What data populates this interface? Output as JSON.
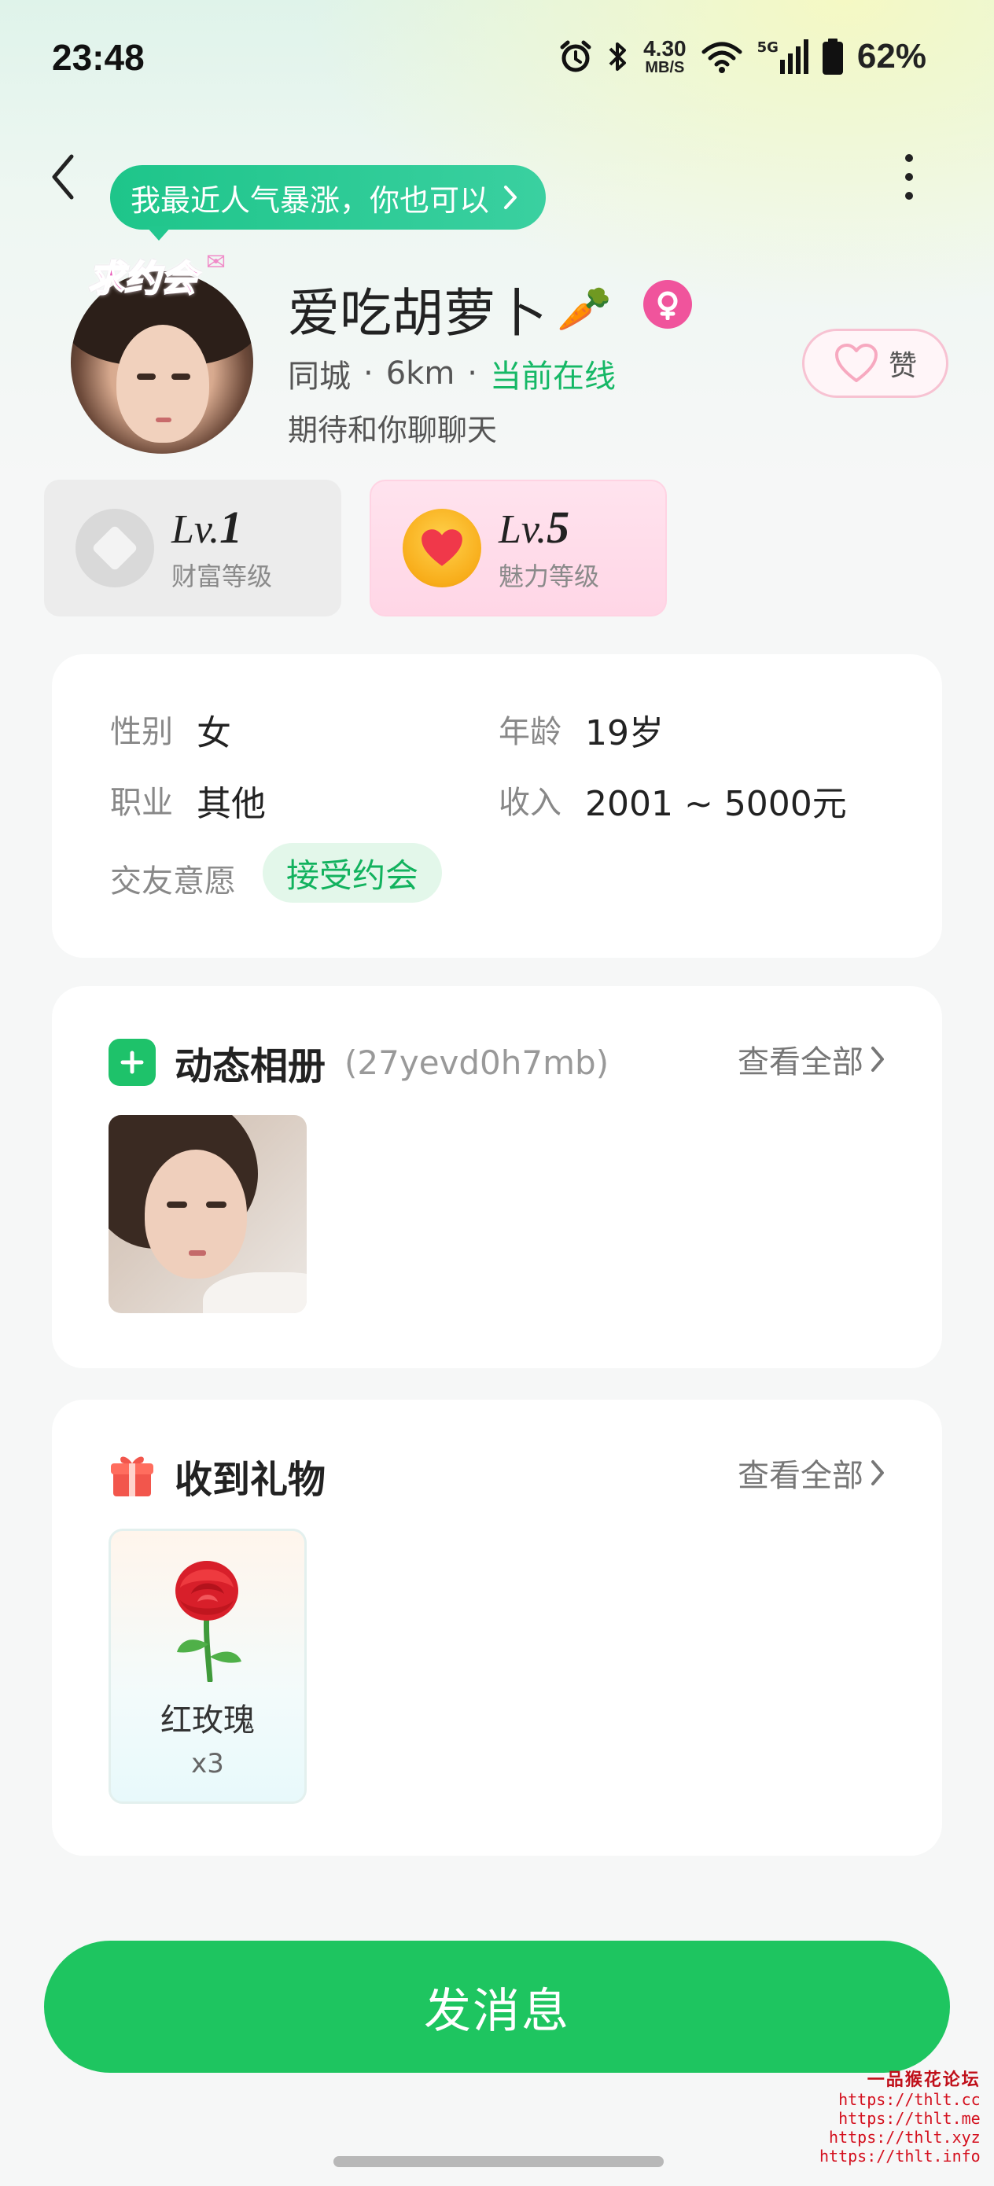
{
  "status_bar": {
    "time": "23:48",
    "net_speed_value": "4.30",
    "net_speed_unit": "MB/S",
    "network_type": "5G",
    "battery": "62%"
  },
  "header": {
    "promo_text": "我最近人气暴涨，你也可以",
    "back_icon": "chevron-left-icon",
    "more_icon": "more-vertical-icon"
  },
  "profile": {
    "avatar_sticker": "求约会",
    "nickname": "爱吃胡萝卜",
    "nickname_emoji": "🥕",
    "gender_symbol": "♀",
    "gender_color": "#f0549c",
    "location": "同城",
    "distance": "6km",
    "online_status": "当前在线",
    "online_color": "#16b866",
    "bio": "期待和你聊聊天",
    "like_label": "赞"
  },
  "levels": {
    "wealth": {
      "prefix": "Lv.",
      "level": "1",
      "label": "财富等级"
    },
    "charm": {
      "prefix": "Lv.",
      "level": "5",
      "label": "魅力等级"
    }
  },
  "info": {
    "gender_label": "性别",
    "gender_value": "女",
    "age_label": "年龄",
    "age_value": "19岁",
    "job_label": "职业",
    "job_value": "其他",
    "income_label": "收入",
    "income_value": "2001 ~ 5000元",
    "intent_label": "交友意愿",
    "intent_value": "接受约会"
  },
  "album": {
    "title": "动态相册",
    "code": "(27yevd0h7mb)",
    "view_all": "查看全部"
  },
  "gifts": {
    "title": "收到礼物",
    "view_all": "查看全部",
    "items": [
      {
        "name": "红玫瑰",
        "count": "x3"
      }
    ]
  },
  "actions": {
    "send_message": "发消息",
    "accent_color": "#1ec560"
  },
  "watermark": {
    "title": "一品猴花论坛",
    "urls": [
      "https://thlt.cc",
      "https://thlt.me",
      "https://thlt.xyz",
      "https://thlt.info"
    ]
  }
}
